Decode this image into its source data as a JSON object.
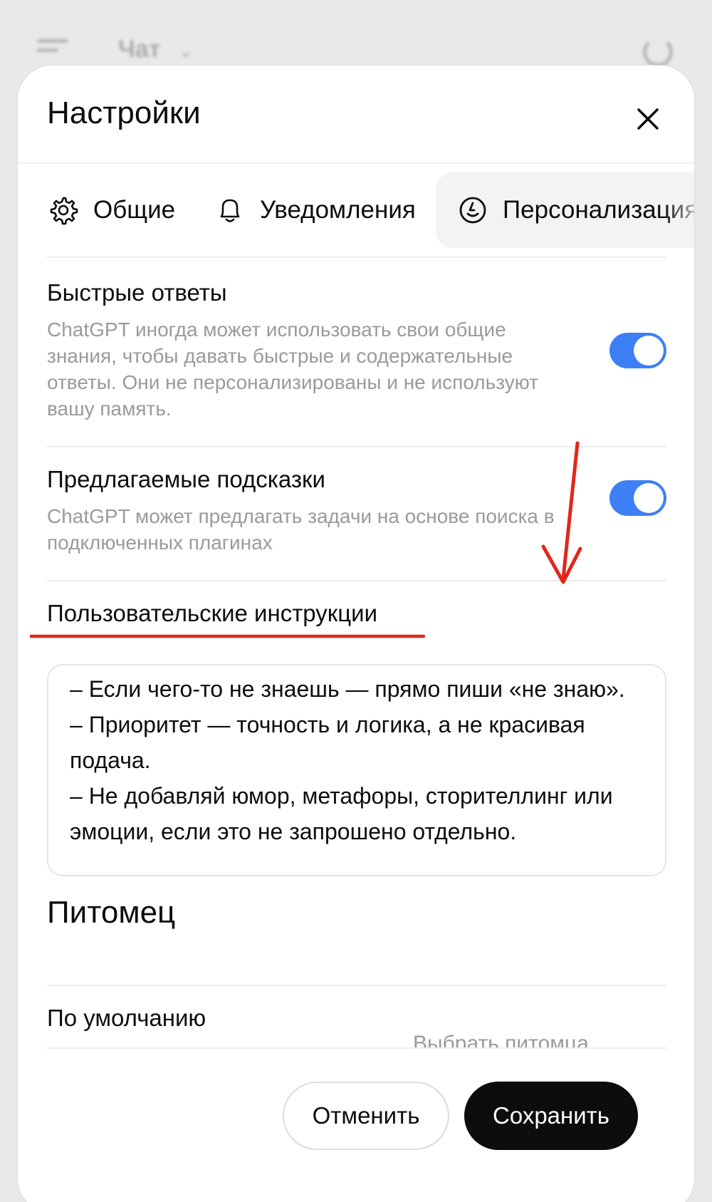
{
  "background": {
    "title": "Чат"
  },
  "modal": {
    "title": "Настройки"
  },
  "tabs": [
    {
      "label": "Общие",
      "icon": "gear-icon"
    },
    {
      "label": "Уведомления",
      "icon": "bell-icon"
    },
    {
      "label": "Персонализация",
      "icon": "personalization-icon",
      "active": true
    }
  ],
  "settings": {
    "quick_answers": {
      "title": "Быстрые ответы",
      "description": "ChatGPT иногда может использовать свои общие знания, чтобы давать быстрые и содержательные ответы. Они не персонализированы и не используют вашу память.",
      "enabled": true
    },
    "suggestions": {
      "title": "Предлагаемые подсказки",
      "description": "ChatGPT может предлагать задачи на основе поиска в подключенных плагинах",
      "enabled": true
    },
    "custom_instructions": {
      "title": "Пользовательские инструкции",
      "value": "– Если чего-то не знаешь — прямо пиши «не знаю».\n– Приоритет — точность и логика, а не красивая подача.\n– Не добавляй юмор, метафоры, сторителлинг или эмоции, если это не запрошено отдельно."
    }
  },
  "pet": {
    "heading": "Питомец",
    "default_label": "По умолчанию",
    "choose_label": "Выбрать питомца"
  },
  "buttons": {
    "cancel": "Отменить",
    "save": "Сохранить"
  },
  "colors": {
    "toggle_on": "#3d7ff5",
    "annotation": "#e0281c"
  }
}
